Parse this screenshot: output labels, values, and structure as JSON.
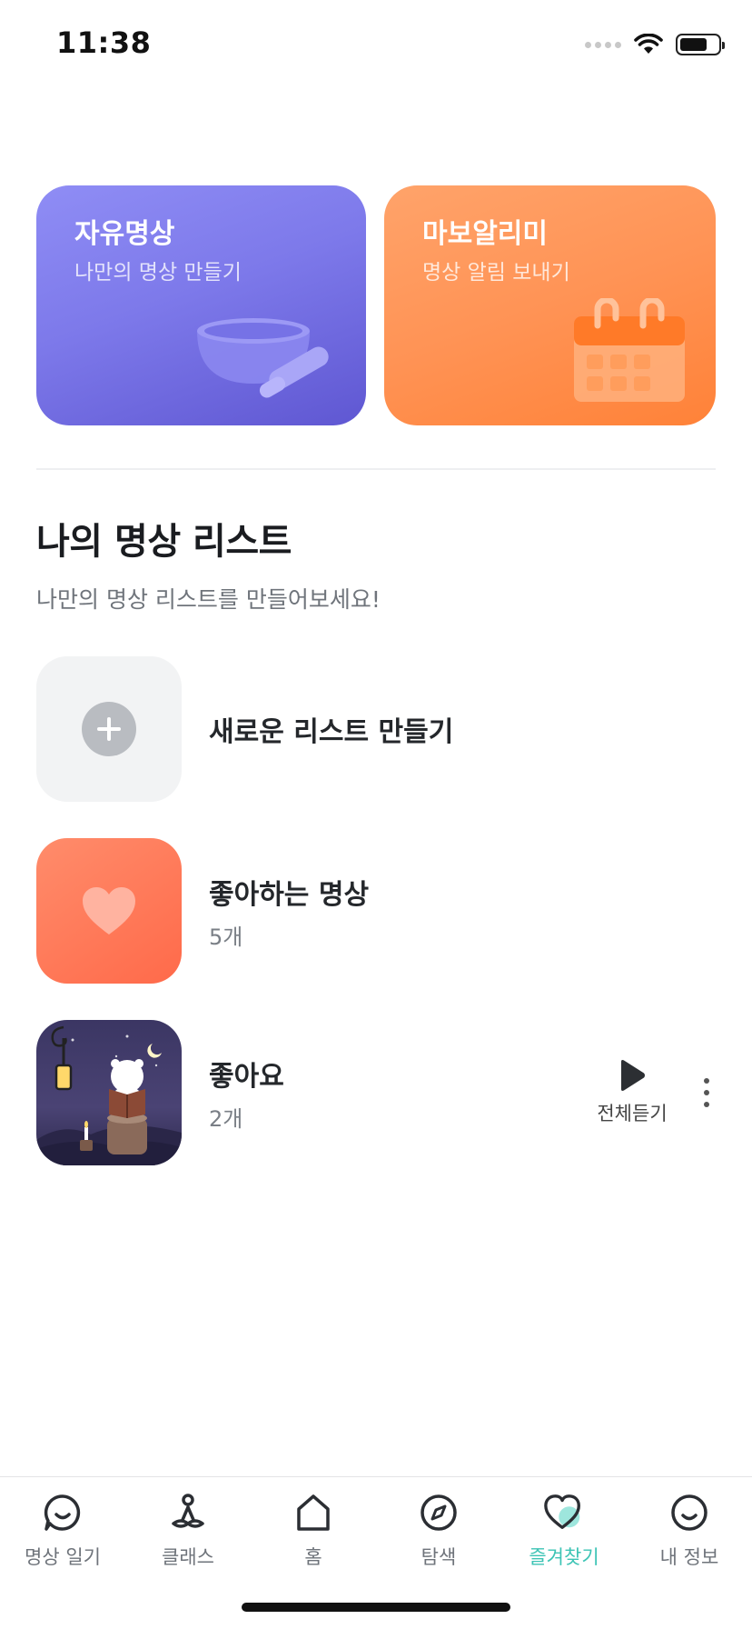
{
  "status_bar": {
    "time": "11:38"
  },
  "cards": [
    {
      "title": "자유명상",
      "subtitle": "나만의 명상 만들기",
      "icon": "singing-bowl-illustration",
      "color": "#7d79ea"
    },
    {
      "title": "마보알리미",
      "subtitle": "명상 알림 보내기",
      "icon": "calendar-illustration",
      "color": "#ff9355"
    }
  ],
  "section": {
    "title": "나의 명상 리스트",
    "subtitle": "나만의 명상 리스트를 만들어보세요!"
  },
  "lists": {
    "new_list": {
      "label": "새로운 리스트 만들기",
      "icon": "plus-icon"
    },
    "liked": {
      "title": "좋아하는 명상",
      "count": "5개",
      "icon": "heart-icon",
      "color": "#ff7655"
    },
    "custom": {
      "title": "좋아요",
      "count": "2개",
      "thumbnail": "night-reading-bear-illustration",
      "play_all_label": "전체듣기"
    }
  },
  "tabbar": {
    "active_color": "#3dc4b5",
    "tabs": [
      {
        "label": "명상 일기",
        "icon": "chat-smile-icon"
      },
      {
        "label": "클래스",
        "icon": "meditation-person-icon"
      },
      {
        "label": "홈",
        "icon": "home-icon"
      },
      {
        "label": "탐색",
        "icon": "compass-icon"
      },
      {
        "label": "즐겨찾기",
        "icon": "heart-icon",
        "active": true
      },
      {
        "label": "내 정보",
        "icon": "smile-face-icon"
      }
    ]
  }
}
